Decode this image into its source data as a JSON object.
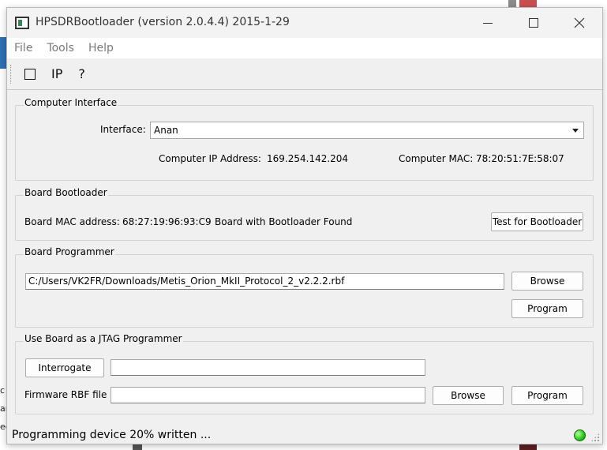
{
  "window": {
    "title": "HPSDRBootloader (version 2.0.4.4) 2015-1-29"
  },
  "menu": [
    "File",
    "Tools",
    "Help"
  ],
  "toolbar": {
    "ip_label": "IP",
    "help_label": "?"
  },
  "computer_interface": {
    "title": "Computer Interface",
    "interface_label": "Interface:",
    "interface_value": "Anan",
    "ip_label": "Computer IP Address:",
    "ip_value": "169.254.142.204",
    "mac_label": "Computer MAC:",
    "mac_value": "78:20:51:7E:58:07"
  },
  "board_bootloader": {
    "title": "Board Bootloader",
    "mac_label": "Board MAC address:",
    "mac_value": "68:27:19:96:93:C9",
    "status": "Board with Bootloader Found",
    "test_button": "Test for Bootloader"
  },
  "board_programmer": {
    "title": "Board Programmer",
    "file_path": "C:/Users/VK2FR/Downloads/Metis_Orion_MkII_Protocol_2_v2.2.2.rbf",
    "browse_button": "Browse",
    "program_button": "Program"
  },
  "jtag": {
    "title": "Use Board as a JTAG Programmer",
    "interrogate_button": "Interrogate",
    "interrogate_value": "",
    "rbf_label": "Firmware RBF file",
    "rbf_value": "",
    "browse_button": "Browse",
    "program_button": "Program"
  },
  "status": {
    "message": "Programming device 20% written ...",
    "led_color": "#2ecb22"
  },
  "background_fragments": [
    "c",
    "ar",
    "ec"
  ]
}
